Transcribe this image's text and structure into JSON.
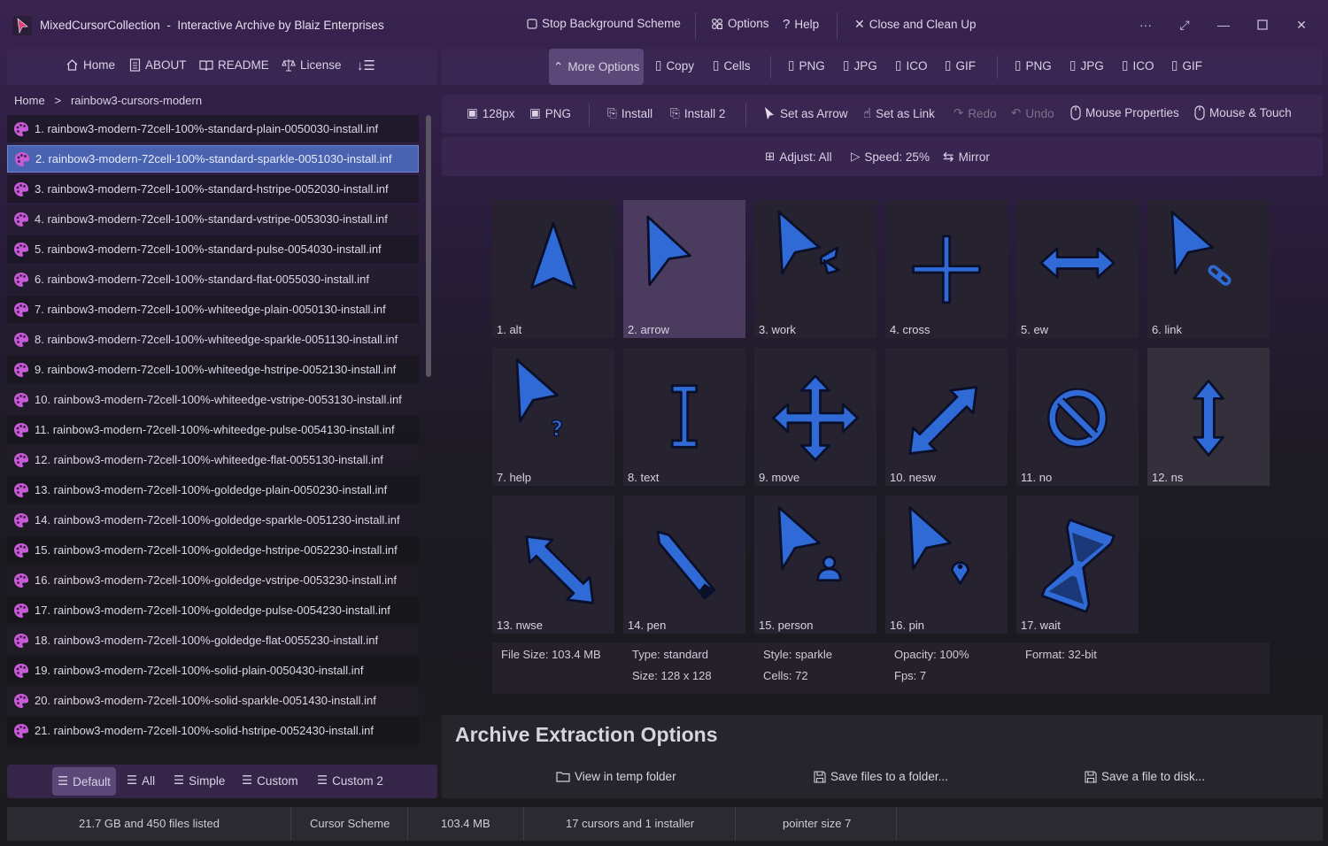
{
  "window": {
    "app_name": "MixedCursorCollection",
    "title_sep": "-",
    "title_rest": "Interactive Archive by Blaiz Enterprises"
  },
  "titlebar": {
    "stop_scheme": "Stop Background Scheme",
    "options": "Options",
    "help": "Help",
    "close_cleanup": "Close and Clean Up"
  },
  "nav": {
    "home": "Home",
    "about": "ABOUT",
    "readme": "README",
    "license": "License"
  },
  "breadcrumb": {
    "root": "Home",
    "sep": ">",
    "current": "rainbow3-cursors-modern"
  },
  "toolbar1": {
    "more_options": "More Options",
    "copy": "Copy",
    "cells": "Cells",
    "png_a": "PNG",
    "jpg_a": "JPG",
    "ico_a": "ICO",
    "gif_a": "GIF",
    "png_b": "PNG",
    "jpg_b": "JPG",
    "ico_b": "ICO",
    "gif_b": "GIF"
  },
  "toolbar2": {
    "size": "128px",
    "png": "PNG",
    "install": "Install",
    "install2": "Install 2",
    "set_arrow": "Set as Arrow",
    "set_link": "Set as Link",
    "redo": "Redo",
    "undo": "Undo",
    "mouse_props": "Mouse Properties",
    "mouse_touch": "Mouse & Touch"
  },
  "toolbar3": {
    "adjust": "Adjust: All",
    "speed": "Speed: 25%",
    "mirror": "Mirror"
  },
  "files": [
    "1. rainbow3-modern-72cell-100%-standard-plain-0050030-install.inf",
    "2. rainbow3-modern-72cell-100%-standard-sparkle-0051030-install.inf",
    "3. rainbow3-modern-72cell-100%-standard-hstripe-0052030-install.inf",
    "4. rainbow3-modern-72cell-100%-standard-vstripe-0053030-install.inf",
    "5. rainbow3-modern-72cell-100%-standard-pulse-0054030-install.inf",
    "6. rainbow3-modern-72cell-100%-standard-flat-0055030-install.inf",
    "7. rainbow3-modern-72cell-100%-whiteedge-plain-0050130-install.inf",
    "8. rainbow3-modern-72cell-100%-whiteedge-sparkle-0051130-install.inf",
    "9. rainbow3-modern-72cell-100%-whiteedge-hstripe-0052130-install.inf",
    "10. rainbow3-modern-72cell-100%-whiteedge-vstripe-0053130-install.inf",
    "11. rainbow3-modern-72cell-100%-whiteedge-pulse-0054130-install.inf",
    "12. rainbow3-modern-72cell-100%-whiteedge-flat-0055130-install.inf",
    "13. rainbow3-modern-72cell-100%-goldedge-plain-0050230-install.inf",
    "14. rainbow3-modern-72cell-100%-goldedge-sparkle-0051230-install.inf",
    "15. rainbow3-modern-72cell-100%-goldedge-hstripe-0052230-install.inf",
    "16. rainbow3-modern-72cell-100%-goldedge-vstripe-0053230-install.inf",
    "17. rainbow3-modern-72cell-100%-goldedge-pulse-0054230-install.inf",
    "18. rainbow3-modern-72cell-100%-goldedge-flat-0055230-install.inf",
    "19. rainbow3-modern-72cell-100%-solid-plain-0050430-install.inf",
    "20. rainbow3-modern-72cell-100%-solid-sparkle-0051430-install.inf",
    "21. rainbow3-modern-72cell-100%-solid-hstripe-0052430-install.inf"
  ],
  "selected_file_index": 1,
  "list_modes": {
    "default": "Default",
    "all": "All",
    "simple": "Simple",
    "custom": "Custom",
    "custom2": "Custom 2"
  },
  "cursors": [
    {
      "label": "1. alt",
      "icon": "alt-cursor-icon"
    },
    {
      "label": "2. arrow",
      "icon": "arrow-cursor-icon"
    },
    {
      "label": "3. work",
      "icon": "work-cursor-icon"
    },
    {
      "label": "4. cross",
      "icon": "cross-cursor-icon"
    },
    {
      "label": "5. ew",
      "icon": "ew-resize-cursor-icon"
    },
    {
      "label": "6. link",
      "icon": "link-cursor-icon"
    },
    {
      "label": "7. help",
      "icon": "help-cursor-icon"
    },
    {
      "label": "8. text",
      "icon": "text-cursor-icon"
    },
    {
      "label": "9. move",
      "icon": "move-cursor-icon"
    },
    {
      "label": "10. nesw",
      "icon": "nesw-resize-cursor-icon"
    },
    {
      "label": "11. no",
      "icon": "no-cursor-icon"
    },
    {
      "label": "12. ns",
      "icon": "ns-resize-cursor-icon"
    },
    {
      "label": "13. nwse",
      "icon": "nwse-resize-cursor-icon"
    },
    {
      "label": "14. pen",
      "icon": "pen-cursor-icon"
    },
    {
      "label": "15. person",
      "icon": "person-cursor-icon"
    },
    {
      "label": "16. pin",
      "icon": "pin-cursor-icon"
    },
    {
      "label": "17. wait",
      "icon": "wait-cursor-icon"
    }
  ],
  "info": {
    "file_size": "File Size: 103.4 MB",
    "type": "Type: standard",
    "size": "Size: 128 x 128",
    "style": "Style: sparkle",
    "cells": "Cells: 72",
    "opacity": "Opacity: 100%",
    "fps": "Fps: 7",
    "format": "Format: 32-bit"
  },
  "archive": {
    "title": "Archive Extraction Options",
    "view_temp": "View in temp folder",
    "save_folder": "Save files to a folder...",
    "save_disk": "Save a file to disk..."
  },
  "status": {
    "listed": "21.7 GB and 450 files listed",
    "kind": "Cursor Scheme",
    "size": "103.4 MB",
    "contents": "17 cursors and 1 installer",
    "pointer": "pointer size 7"
  },
  "colors": {
    "cursor_fill": "#2f6ad6",
    "cursor_outline": "#0a0f2a",
    "selection": "#4a63b0",
    "file_icon": "#c85ad8",
    "app_icon": "#e0407a"
  }
}
